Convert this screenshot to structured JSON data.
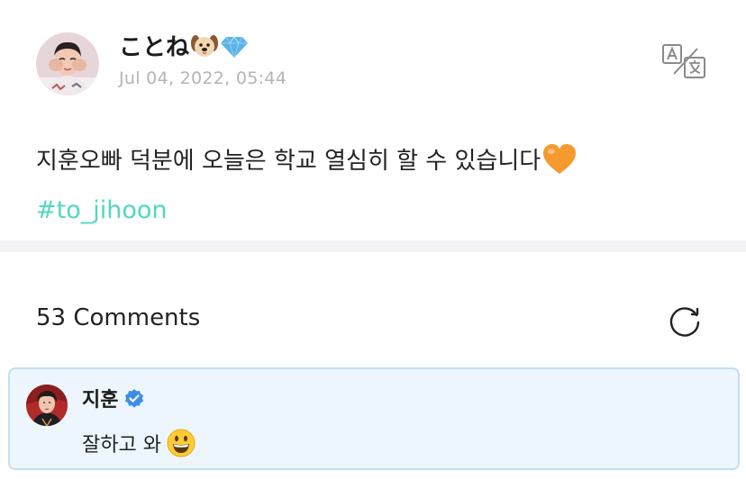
{
  "post": {
    "author": {
      "name": "ことね",
      "name_emojis": [
        "dog-face-emoji",
        "gem-emoji"
      ]
    },
    "timestamp": "Jul 04, 2022, 05:44",
    "text": "지훈오빠 덕분에 오늘은 학교 열심히 할 수 있습니다",
    "text_emoji": "orange-heart-emoji",
    "hashtag": "#to_jihoon",
    "translate_icon": "translate-icon"
  },
  "comments": {
    "count_label": "53 Comments",
    "refresh_icon": "refresh-icon",
    "items": [
      {
        "author": "지훈",
        "verified": true,
        "text": "잘하고 와",
        "text_emoji": "grinning-face-emoji"
      }
    ]
  },
  "colors": {
    "hashtag": "#4fd8c2",
    "timestamp": "#b4b4b8",
    "divider": "#f3f3f6",
    "comment_bg": "#edf6fc",
    "comment_border": "#c2dff0",
    "verified": "#3d8ee8"
  }
}
